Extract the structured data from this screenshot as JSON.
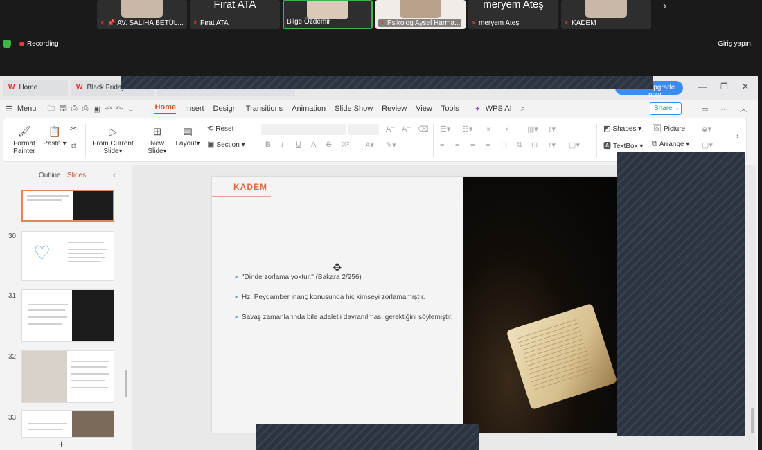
{
  "meeting": {
    "participants": [
      {
        "name": "AV. SALİHA BETÜL...",
        "big_name": "",
        "pinned": true,
        "active": false
      },
      {
        "name": "Fırat ATA",
        "big_name": "Fırat ATA",
        "pinned": false,
        "active": false
      },
      {
        "name": "Bilge Özdemir",
        "big_name": "",
        "pinned": false,
        "active": true
      },
      {
        "name": "Psikolog Aysel Harma...",
        "big_name": "",
        "pinned": false,
        "active": false
      },
      {
        "name": "meryem Ateş",
        "big_name": "meryem Ateş",
        "pinned": false,
        "active": false
      },
      {
        "name": "KADEM",
        "big_name": "",
        "pinned": false,
        "active": false
      }
    ],
    "recording_label": "Recording",
    "signin_label": "Giriş yapın"
  },
  "wps": {
    "tabs": [
      {
        "label": "Home"
      },
      {
        "label": "Black Friday Sale"
      }
    ],
    "upgrade_label": "Upgrade now",
    "menu_label": "Menu",
    "menu_items": [
      "Home",
      "Insert",
      "Design",
      "Transitions",
      "Animation",
      "Slide Show",
      "Review",
      "View",
      "Tools"
    ],
    "wps_ai_label": "WPS AI",
    "share_label": "Share",
    "ribbon": {
      "format_painter": "Format Painter",
      "paste": "Paste",
      "from_current_slide": "From Current Slide",
      "new_slide": "New Slide",
      "layout": "Layout",
      "reset": "Reset",
      "section": "Section",
      "shapes": "Shapes",
      "picture": "Picture",
      "textbox": "TextBox",
      "arrange": "Arrange"
    },
    "panel": {
      "outline_tab": "Outline",
      "slides_tab": "Slides",
      "slide_numbers": [
        "30",
        "31",
        "32",
        "33"
      ]
    },
    "slide": {
      "brand": "KADEM",
      "bullets": [
        "\"Dinde zorlama yoktur.\" (Bakara 2/256)",
        "Hz. Peygamber inanç konusunda hiç kimseyi zorlamamıştır.",
        "Savaş zamanlarında bile adaletli davranılması gerektiğini söylemiştir."
      ]
    }
  },
  "colors": {
    "accent": "#d24c2c",
    "brand": "#d96b45",
    "upgrade": "#3b8cf2",
    "active_speaker": "#3bb54a",
    "recording": "#e23b3b"
  }
}
